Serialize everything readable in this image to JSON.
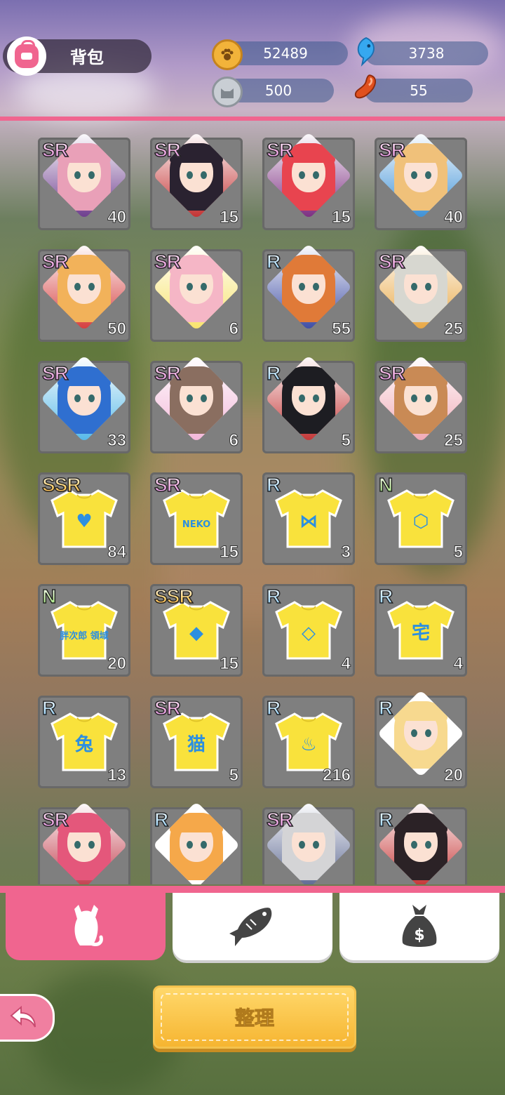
{
  "header": {
    "title": "背包",
    "resources": [
      {
        "name": "paw-coins",
        "value": "52489",
        "icon": "paw-coin-icon",
        "color": "#f2b33a"
      },
      {
        "name": "blue-fish",
        "value": "3738",
        "icon": "blue-fish-icon",
        "color": "#36a8f0"
      },
      {
        "name": "cat-coin",
        "value": "500",
        "icon": "silver-cat-coin-icon",
        "color": "#b8bfc7"
      },
      {
        "name": "bean",
        "value": "55",
        "icon": "red-bean-icon",
        "color": "#e0501e"
      }
    ]
  },
  "items": [
    {
      "rarity": "SR",
      "count": "40",
      "kind": "character",
      "hair": "#e9a0b8",
      "accent": "#6b3a8c"
    },
    {
      "rarity": "SR",
      "count": "15",
      "kind": "character",
      "hair": "#2a2230",
      "accent": "#c22f2f"
    },
    {
      "rarity": "SR",
      "count": "15",
      "kind": "character",
      "hair": "#e8444f",
      "accent": "#7a2a7f"
    },
    {
      "rarity": "SR",
      "count": "40",
      "kind": "character",
      "hair": "#f0c17a",
      "accent": "#3a8fd6"
    },
    {
      "rarity": "SR",
      "count": "50",
      "kind": "character",
      "hair": "#f2b25a",
      "accent": "#d43b3b"
    },
    {
      "rarity": "SR",
      "count": "6",
      "kind": "character",
      "hair": "#f5b6c6",
      "accent": "#f7e36a"
    },
    {
      "rarity": "R",
      "count": "55",
      "kind": "character",
      "hair": "#e07a38",
      "accent": "#3b4aa3"
    },
    {
      "rarity": "SR",
      "count": "25",
      "kind": "character",
      "hair": "#d7d7d0",
      "accent": "#e8a640"
    },
    {
      "rarity": "SR",
      "count": "33",
      "kind": "character",
      "hair": "#2f6fd0",
      "accent": "#54b8e8"
    },
    {
      "rarity": "SR",
      "count": "6",
      "kind": "character",
      "hair": "#8a6e60",
      "accent": "#f3b6d8"
    },
    {
      "rarity": "R",
      "count": "5",
      "kind": "character",
      "hair": "#1d1d22",
      "accent": "#c23333"
    },
    {
      "rarity": "SR",
      "count": "25",
      "kind": "character",
      "hair": "#c98a55",
      "accent": "#f0a8b5"
    },
    {
      "rarity": "SSR",
      "count": "84",
      "kind": "shirt",
      "mark": "♥"
    },
    {
      "rarity": "SR",
      "count": "15",
      "kind": "shirt",
      "mark": "NEKO"
    },
    {
      "rarity": "R",
      "count": "3",
      "kind": "shirt",
      "mark": "⋈"
    },
    {
      "rarity": "N",
      "count": "5",
      "kind": "shirt",
      "mark": "⬡"
    },
    {
      "rarity": "N",
      "count": "20",
      "kind": "shirt",
      "mark": "胖次郎 領域"
    },
    {
      "rarity": "SSR",
      "count": "15",
      "kind": "shirt",
      "mark": "◆"
    },
    {
      "rarity": "R",
      "count": "4",
      "kind": "shirt",
      "mark": "◇"
    },
    {
      "rarity": "R",
      "count": "4",
      "kind": "shirt",
      "mark": "宅"
    },
    {
      "rarity": "R",
      "count": "13",
      "kind": "shirt",
      "mark": "兔"
    },
    {
      "rarity": "SR",
      "count": "5",
      "kind": "shirt",
      "mark": "猫"
    },
    {
      "rarity": "R",
      "count": "216",
      "kind": "shirt",
      "mark": "♨"
    },
    {
      "rarity": "R",
      "count": "20",
      "kind": "character",
      "hair": "#f7d98f",
      "accent": "#ffffff"
    },
    {
      "rarity": "SR",
      "count": "",
      "kind": "character",
      "hair": "#e4577b",
      "accent": "#c13a4a"
    },
    {
      "rarity": "R",
      "count": "",
      "kind": "character",
      "hair": "#f5a84a",
      "accent": "#ffffff"
    },
    {
      "rarity": "SR",
      "count": "",
      "kind": "character",
      "hair": "#d4d4d6",
      "accent": "#5a6690"
    },
    {
      "rarity": "R",
      "count": "",
      "kind": "character",
      "hair": "#2b2226",
      "accent": "#c42f2f"
    }
  ],
  "tabs": [
    {
      "name": "tab-cat",
      "icon": "cat-icon",
      "active": true
    },
    {
      "name": "tab-fish",
      "icon": "fish-icon",
      "active": false
    },
    {
      "name": "tab-money",
      "icon": "money-bag-icon",
      "active": false
    }
  ],
  "buttons": {
    "sort_label": "整理",
    "back_icon": "back-arrow-icon"
  }
}
